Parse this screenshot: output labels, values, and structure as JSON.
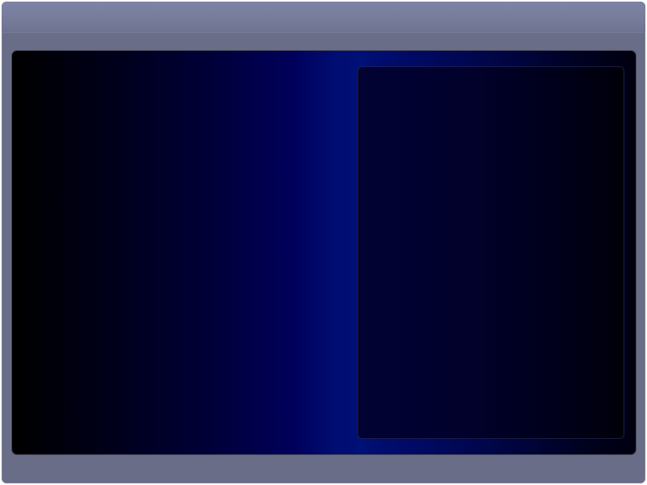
{
  "window": {
    "title": ""
  },
  "colors": {
    "frame": "#6a6d87",
    "titlebar": "#7b7f9e",
    "stage_dark": "#000000",
    "stage_blue": "#001076",
    "panel": "#010130"
  }
}
